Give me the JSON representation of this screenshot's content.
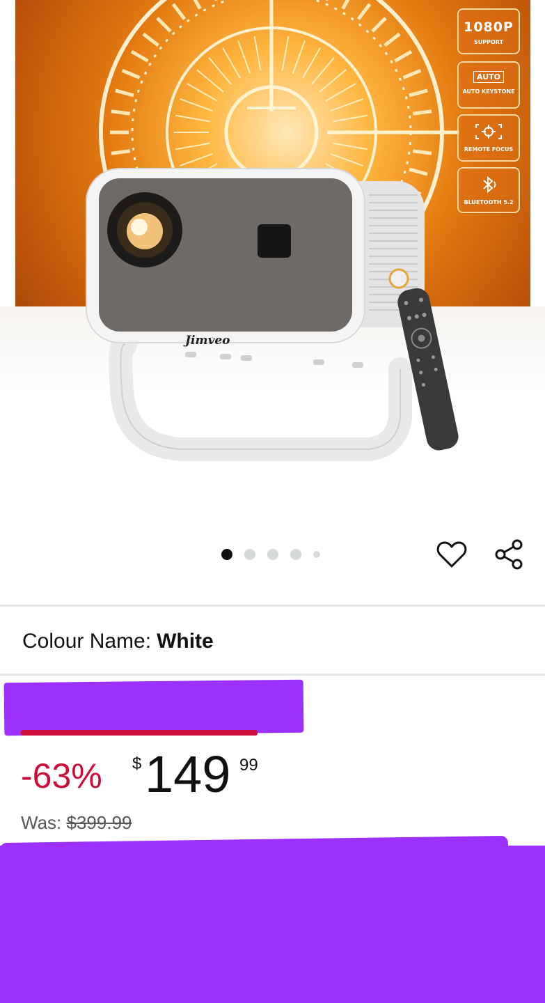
{
  "product_image": {
    "brand_logo": "Jimveo",
    "badges": [
      {
        "title": "1080P",
        "subtitle": "SUPPORT",
        "icon": "text"
      },
      {
        "title": "AUTO",
        "subtitle": "AUTO KEYSTONE",
        "icon": "auto-box-icon"
      },
      {
        "title": "",
        "subtitle": "REMOTE FOCUS",
        "icon": "focus-icon"
      },
      {
        "title": "",
        "subtitle": "BLUETOOTH 5.2",
        "icon": "bluetooth-icon"
      }
    ],
    "carousel": {
      "count": 5,
      "active_index": 0
    }
  },
  "actions": {
    "wishlist_icon": "heart-icon",
    "share_icon": "share-icon"
  },
  "variant": {
    "label": "Colour Name:",
    "value": "White"
  },
  "price": {
    "discount": "-63%",
    "currency": "$",
    "whole": "149",
    "fraction": "99",
    "was_label": "Was:",
    "was_price": "$399.99"
  },
  "colors": {
    "discount_red": "#cc0c39",
    "redaction": "#9b30ff",
    "text": "#0f1111",
    "muted": "#565959"
  }
}
